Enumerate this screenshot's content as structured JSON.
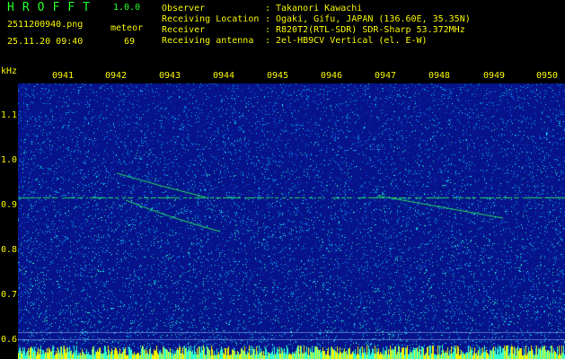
{
  "app": {
    "title": "HROFFT",
    "version": "1.0.0",
    "file_name": "2511200940.png",
    "capture_time": "25.11.20 09:40",
    "meteor_label": "meteor",
    "meteor_count": "69"
  },
  "info": {
    "separator": ":",
    "observer_label": "Observer",
    "observer_value": "Takanori Kawachi",
    "location_label": "Receiving Location",
    "location_value": "Ogaki, Gifu, JAPAN (136.60E, 35.35N)",
    "receiver_label": "Receiver",
    "receiver_value": "R820T2(RTL-SDR) SDR-Sharp 53.372MHz",
    "antenna_label": "Receiving antenna",
    "antenna_value": "2el-HB9CV Vertical (el. E-W)"
  },
  "axis": {
    "unit": "kHz",
    "time_ticks": [
      "0941",
      "0942",
      "0943",
      "0944",
      "0945",
      "0946",
      "0947",
      "0948",
      "0949",
      "0950"
    ],
    "freq_ticks": [
      "1.1",
      "1.0",
      "0.9",
      "0.8",
      "0.7",
      "0.6"
    ]
  },
  "colors": {
    "background": "#000000",
    "spectrum_base": "#06138a",
    "label_yellow": "#f4f400",
    "title_green": "#22ff22",
    "signal_green": "#22e060",
    "noise_cyan": "#00d8ff"
  }
}
